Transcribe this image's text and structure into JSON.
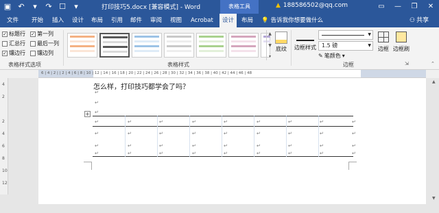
{
  "qat": {
    "save_icon": "save-icon",
    "undo_icon": "undo-icon",
    "undo_dropdown_icon": "chevron-down-icon",
    "redo_icon": "redo-icon",
    "touch_icon": "touch-mode-icon",
    "customize_icon": "customize-qat-icon"
  },
  "window": {
    "title": "打印技巧5.docx [兼容模式] - Word",
    "context_tab_group": "表格工具",
    "account": "188586502@qq.com",
    "controls": [
      "—",
      "❐",
      "✕"
    ]
  },
  "tabs": {
    "items": [
      "文件",
      "开始",
      "插入",
      "设计",
      "布局",
      "引用",
      "邮件",
      "审阅",
      "视图",
      "Acrobat",
      "设计",
      "布局"
    ],
    "active_index": 10,
    "tell_me": "告诉我你想要做什么",
    "share": "共享"
  },
  "table_style_options": {
    "label": "表格样式选项",
    "options": [
      {
        "label": "标题行",
        "checked": true
      },
      {
        "label": "第一列",
        "checked": true
      },
      {
        "label": "汇总行",
        "checked": false
      },
      {
        "label": "最后一列",
        "checked": false
      },
      {
        "label": "镶边行",
        "checked": true
      },
      {
        "label": "镶边列",
        "checked": false
      }
    ]
  },
  "table_styles": {
    "label": "表格样式",
    "swatch_colors": [
      "#f4b183",
      "#595959",
      "#9dc3e6",
      "#c9c9c9",
      "#a9d18e",
      "#d5a6bd",
      "#b4a7d6"
    ],
    "selected_index": 1,
    "shading_label": "底纹"
  },
  "borders": {
    "label": "边框",
    "border_styles_label": "边框样式",
    "pen_weight": "1.5 磅",
    "pen_color_label": "笔颜色",
    "borders_label": "边框",
    "painter_label": "边框刷"
  },
  "ruler": {
    "marks": "6 | 4 | 2 |   | 2 | 4 | 6 | 8 | 10 | 12 | 14 | 16 | 18 | 20 | 22 | 24 | 26 | 28 | 30 | 32 | 34 | 36 | 38 | 40 | 42 | 44 | 46 | 48"
  },
  "document": {
    "text": "怎么样，打印技巧都学会了吗？",
    "para_mark": "↵",
    "table_handle": "+"
  }
}
